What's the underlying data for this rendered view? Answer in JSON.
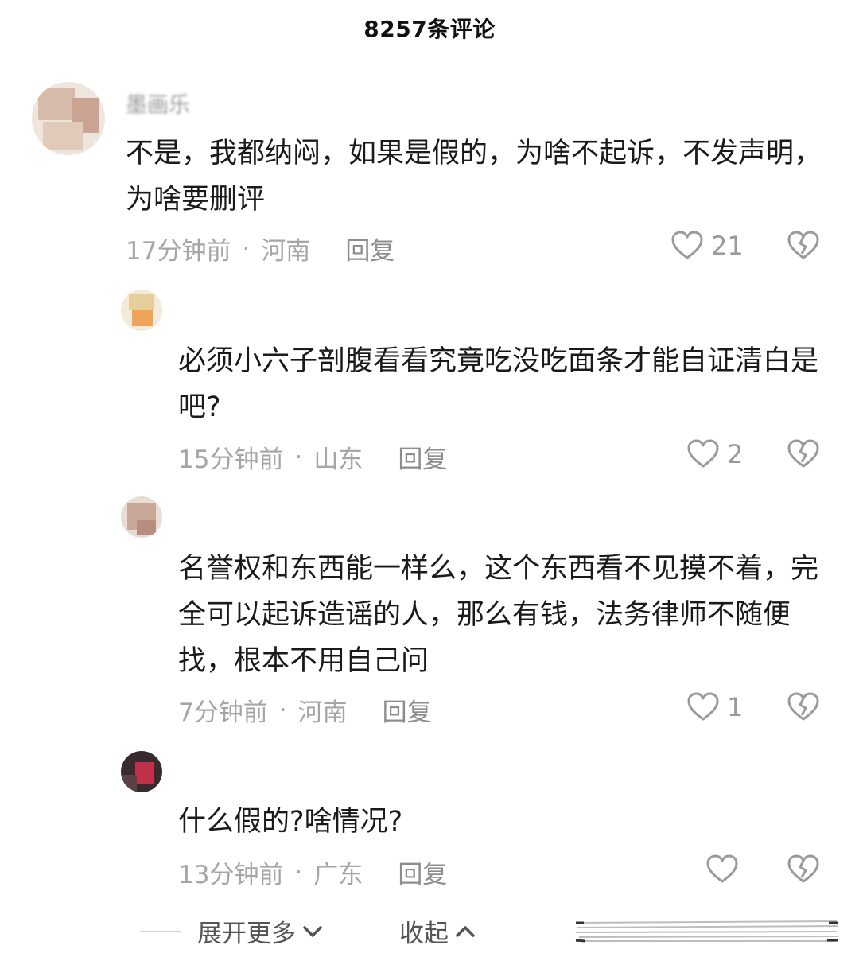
{
  "header": {
    "title": "8257条评论"
  },
  "comments": [
    {
      "author": "墨画乐",
      "text": "不是，我都纳闷，如果是假的，为啥不起诉，不发声明，为啥要删评",
      "time": "17分钟前",
      "location": "河南",
      "reply": "回复",
      "likes": "21"
    },
    {
      "author": "",
      "text": "必须小六子剖腹看看究竟吃没吃面条才能自证清白是吧?",
      "time": "15分钟前",
      "location": "山东",
      "reply": "回复",
      "likes": "2"
    },
    {
      "author": "",
      "text": "名誉权和东西能一样么，这个东西看不见摸不着，完全可以起诉造谣的人，那么有钱，法务律师不随便找，根本不用自己问",
      "time": "7分钟前",
      "location": "河南",
      "reply": "回复",
      "likes": "1"
    },
    {
      "author": "",
      "text": "什么假的?啥情况?",
      "time": "13分钟前",
      "location": "广东",
      "reply": "回复",
      "likes": ""
    }
  ],
  "footer": {
    "expand": "展开更多",
    "collapse": "收起"
  },
  "icons": {
    "like": "heart-outline-icon",
    "dislike": "broken-heart-icon",
    "expand": "chevron-down-icon",
    "collapse": "chevron-up-icon"
  },
  "colors": {
    "text": "#1a1a1a",
    "meta": "#a6a6a6",
    "icon": "#9a9a9a"
  }
}
